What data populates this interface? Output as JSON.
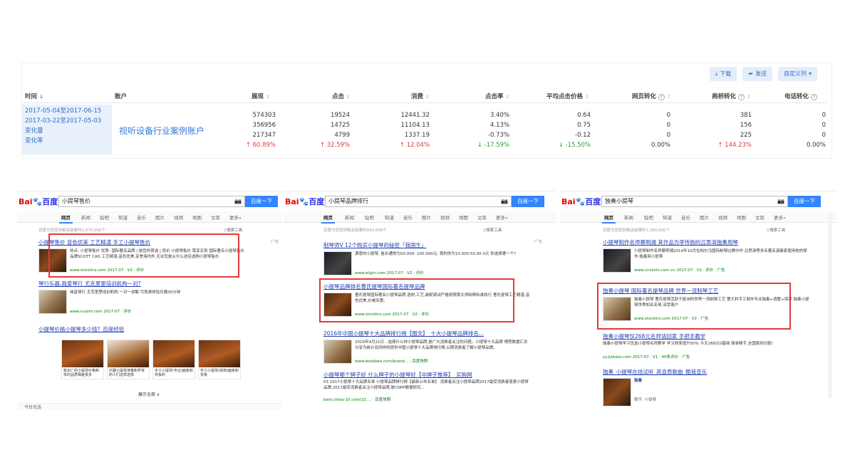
{
  "report": {
    "toolbar": [
      {
        "icon": "download-icon",
        "label": "下载"
      },
      {
        "icon": "send-icon",
        "label": "发送"
      },
      {
        "icon": "chevron-down-icon",
        "label": "自定义列"
      }
    ],
    "columns": {
      "time": "时间",
      "account": "账户",
      "impressions": "展现",
      "clicks": "点击",
      "cost": "消费",
      "ctr": "点击率",
      "avg_cpc": "平均点击价格",
      "web_conv": "网页转化",
      "bridge_conv": "商桥转化",
      "phone_conv": "电话转化"
    },
    "rows_labels": [
      "2017-05-04至2017-06-15",
      "2017-03-22至2017-05-03",
      "变化量",
      "变化率"
    ],
    "account_name": "视听设备行业案例账户",
    "values": {
      "impressions": [
        "574303",
        "356956",
        "217347",
        "↑ 60.89%"
      ],
      "clicks": [
        "19524",
        "14725",
        "4799",
        "↑ 32.59%"
      ],
      "cost": [
        "12441.32",
        "11104.13",
        "1337.19",
        "↑ 12.04%"
      ],
      "ctr": [
        "3.40%",
        "4.13%",
        "-0.73%",
        "↓ -17.59%"
      ],
      "avg_cpc": [
        "0.64",
        "0.75",
        "-0.12",
        "↓ -15.50%"
      ],
      "web_conv": [
        "0",
        "0",
        "0",
        "0.00%"
      ],
      "bridge_conv": [
        "381",
        "156",
        "225",
        "↑ 144.23%"
      ],
      "phone_conv": [
        "0",
        "0",
        "0",
        "0.00%"
      ]
    }
  },
  "baidu": {
    "logo": {
      "bai": "Bai",
      "paw": "du",
      "cn": "百度"
    },
    "button": "百度一下",
    "tabs": [
      "网页",
      "新闻",
      "贴吧",
      "知道",
      "音乐",
      "图片",
      "视频",
      "地图",
      "文库",
      "更多»"
    ],
    "tools": "▽搜索工具",
    "ad": "广告",
    "panels": [
      {
        "query": "小提琴售价",
        "stats": "百度为您找到相关结果约2,070,000个",
        "results": [
          {
            "title": "小提琴售价 音色优美 工艺精湛 手工小提琴售价",
            "text": "热点: 小提琴售价 优势: 国际著名品牌 | 是您的首选 | 低价 小提琴售价 尊享买卖 国际著名小提琴售价品牌SCOTT CAO 工艺精湛,音色优美,享誉海内外,无论您是从什么途径选购小提琴售价",
            "url": "www.stviolins.com 2017-07 · V2 · 评价"
          },
          {
            "title": "琴行乐器,我爱琴行 尤克里里培训机构一对?",
            "text": "纯音琴行 尤克里里培训机构 一对一讲解 可免费体验乐器30分钟",
            "url": "www.nuomi.com 2017-07 · 评价"
          },
          {
            "title": "小提琴价格小提琴多少钱?_百度经验",
            "text": "",
            "url": ""
          }
        ],
        "images": [
          "新出厂的小提琴价格和琴的品质相差很多",
          "乐器小提琴演奏和学琴的人们这样选择",
          "手工小提琴(专业)面板和背板的",
          "手工小提琴(高档)面板和背板"
        ],
        "more": "展示全部 ∨",
        "footer": "今日优选"
      },
      {
        "query": "小提琴品牌排行",
        "stats": "百度为您找到相关结果约934,000个",
        "results": [
          {
            "title": "制琴师V 12个购买小提琴的秘密「我国生」",
            "text": "满意的小提琴, 售价通常为50.000- 100.000元; 我的你为10.000-50.00 0元 你选择哪一个?",
            "url": "www.eligin.com 2017-07 · V2 · 评价"
          },
          {
            "title": "小提琴品牌排名曹氏提琴国际著名提琴品牌",
            "text": "曹氏提琴国际著名小提琴品牌 选材,工艺,装配调试严格按照尊大师制琴标准执行 曹氏提琴工艺精湛,音色优美,价格实惠。",
            "url": "www.stviolins.com 2017-07 · V2 · 评价"
          },
          {
            "title": "2016年中国小提琴十大品牌排行榜【图文】_十大小提琴品牌排名...",
            "text": "2016年4月21日 - 选择什么样小提琴品牌,是广大消费者关注的问题。小提琴十大品牌 博思数据汇总分享为统计及同样的提供中国小提琴十大品牌排行榜,以期消费者了解小提琴品牌。",
            "url": "www.bosidata.com/brand... · 百度快照"
          },
          {
            "title": "小提琴哪个牌子好 什么牌子的小提琴好【中牌子推荐】_买购网",
            "text": "03 2017小提琴十大品牌名单 小提琴品牌排行榜【最新公布名单】 消费者关注小提琴品牌2017最受消费者喜爱小提琴品牌,2017最受消费者关注小提琴品牌,是CNPP数据研究...",
            "url": "best.china-10.com/22.... · 百度快照"
          }
        ],
        "footer": ""
      },
      {
        "query": "独奏小提琴",
        "stats": "百度为您找到相关结果约7,260,000个",
        "results": [
          {
            "title": "小提琴制作名师蔡明湘 其作品为李传韵的吕思清独奏用琴",
            "text": "小提琴制作名师蔡明湘2014年10月在帕尔马国际制琴比赛中作 吕思清等多名著名演奏家使用他的琴作 独奏用小提琴",
            "url": "www.cnviolin.com.cn 2017-07 · V2 · 评价 · 广告"
          },
          {
            "title": "独奏小提琴 国际著名提琴品牌 世界一流制琴工艺",
            "text": "独奏小提琴 曹氏提琴活跃于欧洲的世界一流制琴工艺 曹大利手工制作专业独奏+调整+保养 独奏小提琴世界知名名琴,深受客户",
            "url": "www.stviolins.com 2017-07 · V2 · 广告"
          },
          {
            "title": "独奏小提琴仅268元名师请回家 手把手教学",
            "text": "独奏小提琴学习优选小提琴名师教学 学习效率提升50% 今天268元0基础 简单精手,全国挑到付款!",
            "url": "yy.jixbdzz.com 2017-07 · V1 · 40条评价 · 广告"
          },
          {
            "title": "独奏_小提琴在线试听_高音质歌曲_酷我音乐",
            "text": "独奏",
            "url": "歌手: 小提琴"
          }
        ],
        "footer": ""
      }
    ]
  },
  "colors": {
    "accent": "#3385ff",
    "red_box": "#e4393c",
    "up": "#e4393c",
    "down": "#2e9d3a",
    "date_bg": "#e8f0fb"
  }
}
